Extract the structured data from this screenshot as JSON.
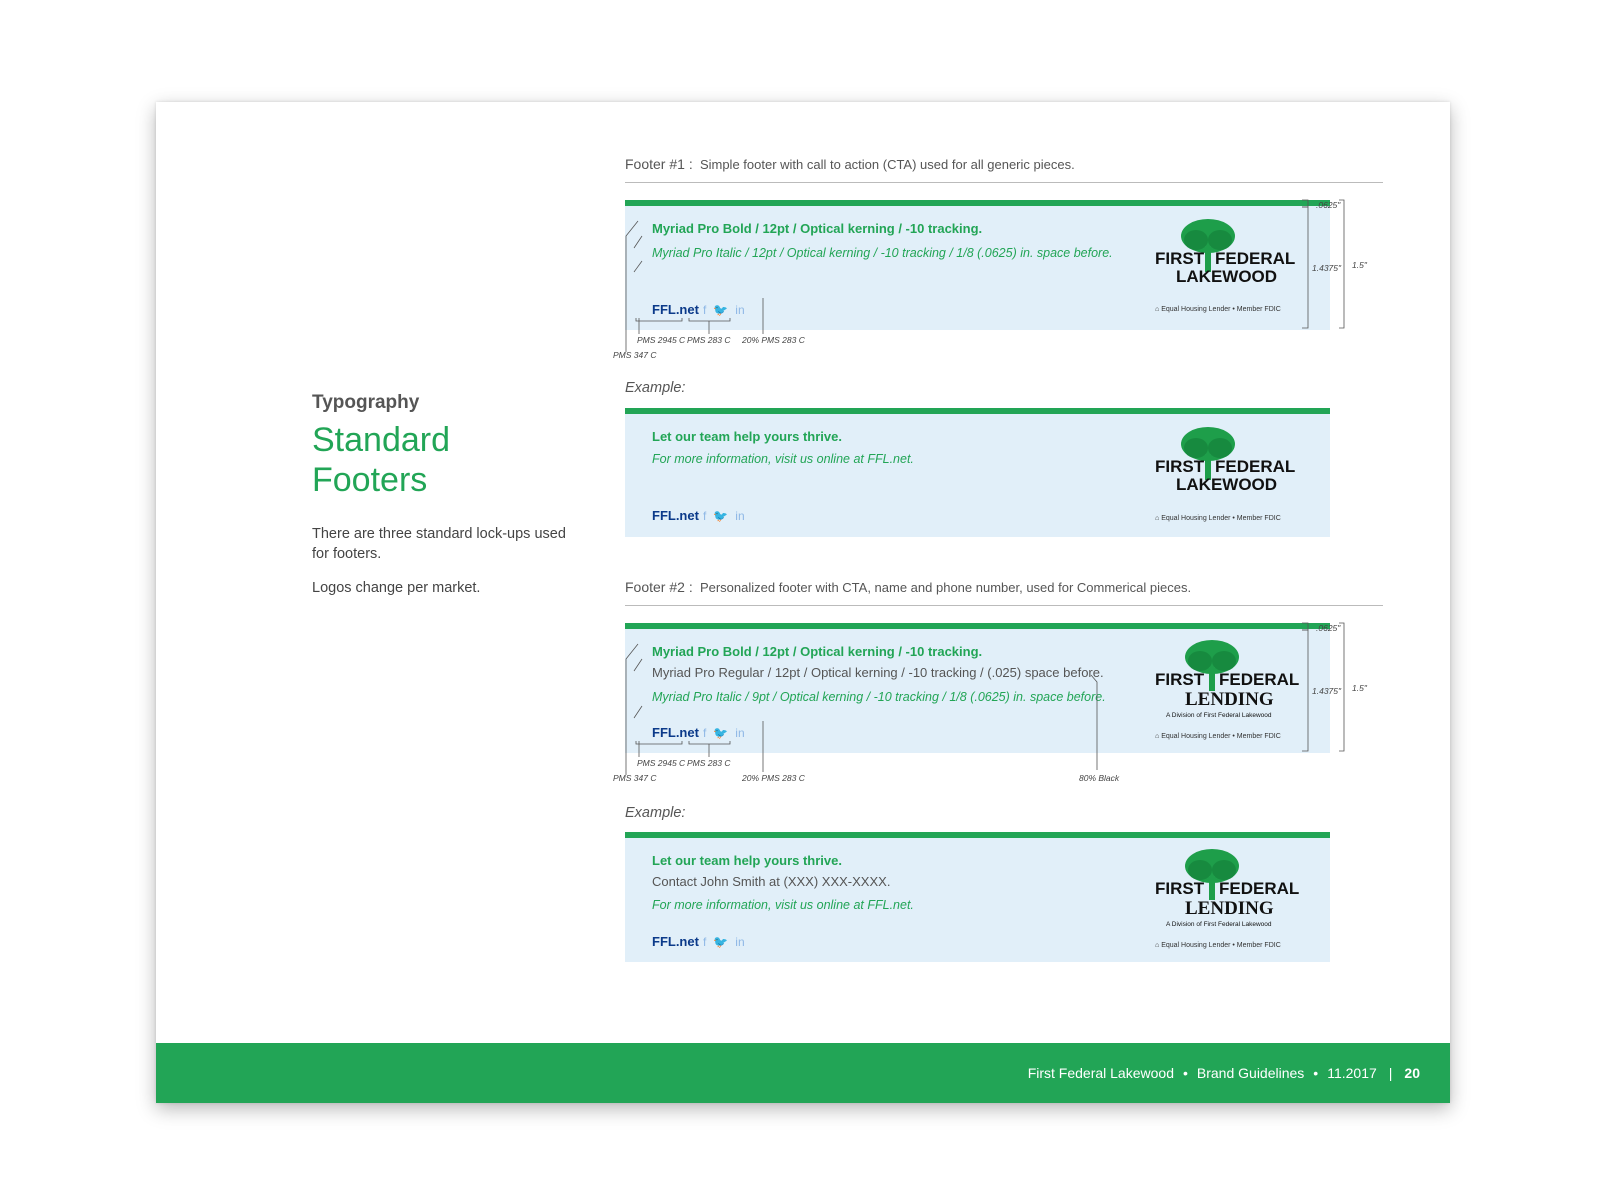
{
  "sidebar": {
    "kicker": "Typography",
    "title_line1": "Standard",
    "title_line2": "Footers",
    "intro": "There are three standard lock-ups used for footers.",
    "note": "Logos change per market."
  },
  "footer1": {
    "heading_num": "Footer #1 :",
    "heading_desc": "Simple footer with call to action (CTA) used for all generic pieces.",
    "spec_bold": "Myriad Pro Bold / 12pt / Optical kerning / -10 tracking.",
    "spec_italic": "Myriad Pro Italic / 12pt / Optical kerning / -10 tracking / 1/8 (.0625) in. space before.",
    "url": "FFL.net",
    "logo_line1": "FIRST FEDERAL",
    "logo_line2": "LAKEWOOD",
    "equal_housing": "Equal Housing Lender • Member FDIC",
    "ann_pms2945": "PMS 2945 C",
    "ann_pms283": "PMS 283 C",
    "ann_20pms283": "20% PMS 283 C",
    "ann_pms347": "PMS 347 C",
    "dim_top": ".0625\"",
    "dim_body": "1.4375\"",
    "dim_total": "1.5\""
  },
  "example1": {
    "label": "Example:",
    "cta": "Let our team help yours thrive.",
    "info": "For more information, visit us online at FFL.net.",
    "url": "FFL.net",
    "logo_line1": "FIRST FEDERAL",
    "logo_line2": "LAKEWOOD",
    "equal_housing": "Equal Housing Lender • Member FDIC"
  },
  "footer2": {
    "heading_num": "Footer #2 :",
    "heading_desc": "Personalized footer with CTA, name and phone number, used for Commerical pieces.",
    "spec_bold": "Myriad Pro Bold / 12pt / Optical kerning / -10 tracking.",
    "spec_regular": "Myriad Pro Regular / 12pt / Optical kerning / -10 tracking / (.025) space before.",
    "spec_italic": "Myriad Pro Italic / 9pt / Optical kerning / -10 tracking / 1/8 (.0625) in. space before.",
    "url": "FFL.net",
    "logo_line1": "FIRST FEDERAL",
    "logo_line2": "LENDING",
    "logo_sub": "A Division of First Federal Lakewood",
    "equal_housing": "Equal Housing Lender • Member FDIC",
    "ann_pms2945": "PMS 2945 C",
    "ann_pms283": "PMS 283 C",
    "ann_20pms283": "20% PMS 283 C",
    "ann_pms347": "PMS 347 C",
    "ann_80black": "80% Black",
    "dim_top": ".0625\"",
    "dim_body": "1.4375\"",
    "dim_total": "1.5\""
  },
  "example2": {
    "label": "Example:",
    "cta": "Let our team help yours thrive.",
    "contact": "Contact John Smith at (XXX) XXX-XXXX.",
    "info": "For more information, visit us online at FFL.net.",
    "url": "FFL.net",
    "logo_line1": "FIRST FEDERAL",
    "logo_line2": "LENDING",
    "logo_sub": "A Division of First Federal Lakewood",
    "equal_housing": "Equal Housing Lender • Member FDIC"
  },
  "page_footer": {
    "brand": "First Federal Lakewood",
    "doc": "Brand Guidelines",
    "date": "11.2017",
    "page": "20"
  },
  "colors": {
    "brand_green": "#22a556",
    "banner_blue": "#e1eff9",
    "url_blue": "#0b3a8a",
    "social_blue": "#8fb8e6"
  },
  "icons": [
    "facebook-icon",
    "twitter-icon",
    "linkedin-icon",
    "house-icon",
    "tree-icon"
  ]
}
